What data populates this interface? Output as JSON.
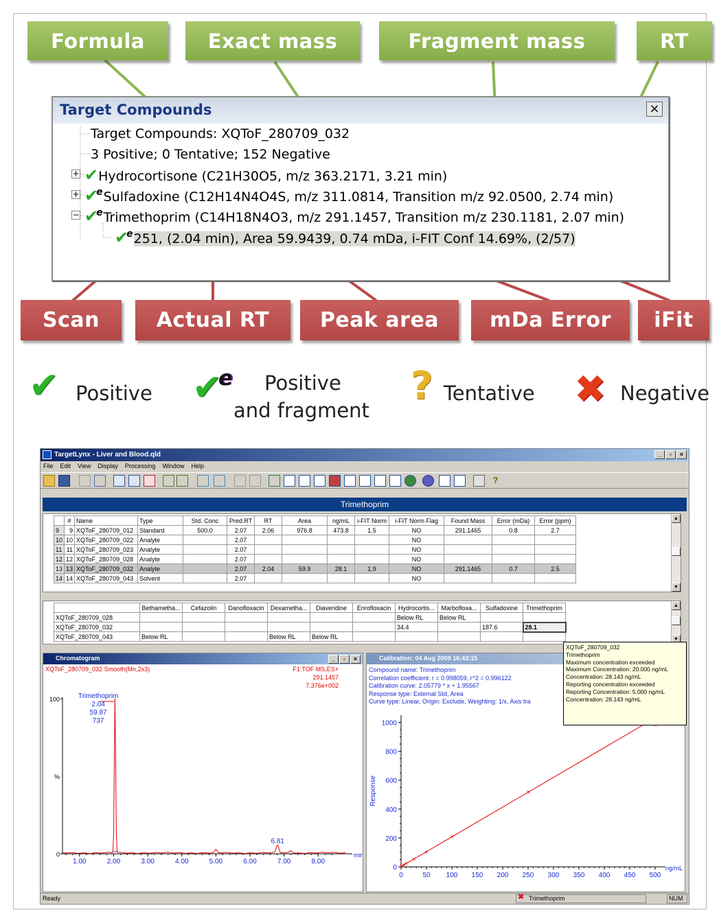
{
  "callouts_top": [
    "Formula",
    "Exact mass",
    "Fragment mass",
    "RT"
  ],
  "callouts_bottom": [
    "Scan",
    "Actual RT",
    "Peak area",
    "mDa Error",
    "iFit"
  ],
  "target_window": {
    "title": "Target Compounds",
    "close": "×",
    "rows": [
      "Target Compounds: XQToF_280709_032",
      "3 Positive; 0 Tentative; 152 Negative",
      "Hydrocortisone (C21H30O5, m/z 363.2171, 3.21 min)",
      "Sulfadoxine (C12H14N4O4S, m/z 311.0814, Transition m/z 92.0500, 2.74 min)",
      "Trimethoprim (C14H18N4O3, m/z 291.1457, Transition m/z 230.1181, 2.07 min)",
      "251, (2.04 min), Area 59.9439, 0.74 mDa, i-FIT Conf 14.69%, (2/57)"
    ],
    "expand_plus": "+",
    "expand_minus": "−",
    "check": "✔",
    "fragment_mark": "e"
  },
  "legend": {
    "positive": "Positive",
    "positive_fragment_1": "Positive",
    "positive_fragment_2": "and fragment",
    "tentative": "Tentative",
    "negative": "Negative",
    "check_icon": "✔",
    "question_icon": "?",
    "cross_icon": "✖"
  },
  "app": {
    "title": "TargetLynx - Liver and Blood.qld",
    "menu": [
      "File",
      "Edit",
      "View",
      "Display",
      "Processing",
      "Window",
      "Help"
    ],
    "band_title": "Trimethoprim",
    "status_ready": "Ready",
    "status_compound": "Trimethoprim",
    "status_num": "NUM",
    "winbtns": [
      "_",
      "▫",
      "×"
    ]
  },
  "table1": {
    "headers": [
      "",
      "#",
      "Name",
      "Type",
      "Std. Conc",
      "Pred.RT",
      "RT",
      "Area",
      "ng/mL",
      "i-FIT Norm",
      "i-FIT Norm Flag",
      "Found Mass",
      "Error (mDa)",
      "Error (ppm)"
    ],
    "rows": [
      [
        "9",
        "9",
        "XQToF_280709_012",
        "Standard",
        "500.0",
        "2.07",
        "2.06",
        "976.8",
        "473.8",
        "1.5",
        "NO",
        "291.1465",
        "0.8",
        "2.7"
      ],
      [
        "10",
        "10",
        "XQToF_280709_022",
        "Analyte",
        "",
        "2.07",
        "",
        "",
        "",
        "",
        "NO",
        "",
        "",
        ""
      ],
      [
        "11",
        "11",
        "XQToF_280709_023",
        "Analyte",
        "",
        "2.07",
        "",
        "",
        "",
        "",
        "NO",
        "",
        "",
        ""
      ],
      [
        "12",
        "12",
        "XQToF_280709_028",
        "Analyte",
        "",
        "2.07",
        "",
        "",
        "",
        "",
        "NO",
        "",
        "",
        ""
      ],
      [
        "13",
        "13",
        "XQToF_280709_032",
        "Analyte",
        "",
        "2.07",
        "2.04",
        "59.9",
        "28.1",
        "1.9",
        "NO",
        "291.1465",
        "0.7",
        "2.5"
      ],
      [
        "14",
        "14",
        "XQToF_280709_043",
        "Solvent",
        "",
        "2.07",
        "",
        "",
        "",
        "",
        "NO",
        "",
        "",
        ""
      ]
    ]
  },
  "table2": {
    "headers": [
      "",
      "Bethametha...",
      "Cefazolin",
      "Danofloxacin",
      "Dexametha...",
      "Diaveridine",
      "Enrofloxacin",
      "Hydrocortis...",
      "Marbofloxa...",
      "Sulfadoxine",
      "Trimethoprim"
    ],
    "rows": [
      [
        "XQToF_280709_028",
        "",
        "",
        "",
        "",
        "",
        "",
        "Below RL",
        "Below RL",
        "",
        ""
      ],
      [
        "XQToF_280709_032",
        "",
        "",
        "",
        "",
        "",
        "",
        "34.4",
        "",
        "187.6",
        "28.1"
      ],
      [
        "XQToF_280709_043",
        "Below RL",
        "",
        "",
        "Below RL",
        "Below RL",
        "",
        "",
        "",
        "",
        ""
      ]
    ]
  },
  "chromatogram": {
    "title": "Chromatogram",
    "trace_label": "XQToF_280709_032 Smooth(Mn,2x3)",
    "func_label": "F1:TOF MS,ES+",
    "mass_label": "291.1457",
    "intensity_label": "7.376e+002",
    "peak_name": "Trimethoprim",
    "peak_rt": "2.04",
    "peak_area": "59.87",
    "peak_height": "737",
    "minor_peak": "6.81",
    "y_top": "100",
    "y_pct": "%",
    "y_zero": "0",
    "x_unit": "min",
    "x_ticks": [
      "1.00",
      "2.00",
      "3.00",
      "4.00",
      "5.00",
      "6.00",
      "7.00",
      "8.00"
    ]
  },
  "calibration": {
    "title": "Calibration: 04 Aug 2009 16:43:15",
    "lines": [
      "Compound name: Trimethoprim",
      "Correlation coefficient: r = 0.998059, r^2 = 0.996122",
      "Calibration curve: 2.05779 * x + 1.95567",
      "Response type: External Std, Area",
      "Curve type: Linear, Origin: Exclude, Weighting: 1/x, Axis tra"
    ],
    "ylabel": "Response",
    "xlabel": "ng/mL",
    "y_ticks": [
      "1000",
      "800",
      "600",
      "400",
      "200",
      "0"
    ],
    "x_ticks": [
      "0",
      "50",
      "100",
      "150",
      "200",
      "250",
      "300",
      "350",
      "400",
      "450",
      "500"
    ]
  },
  "tooltip": [
    "XQToF_280709_032",
    "Trimethoprim",
    "Maximum concentration exceeded",
    "Maximum Concentration: 20.000 ng/mL",
    "Concentration: 28.143 ng/mL",
    "Reporting concentration exceeded",
    "Reporting Concentration: 5.000 ng/mL",
    "Concentration: 28.143 ng/mL"
  ],
  "colors": {
    "callout_green": "#8fb554",
    "callout_red": "#b94b4a",
    "band_blue": "#0a3d86",
    "trace_red": "#e00000",
    "check_green": "#2bb32b"
  }
}
